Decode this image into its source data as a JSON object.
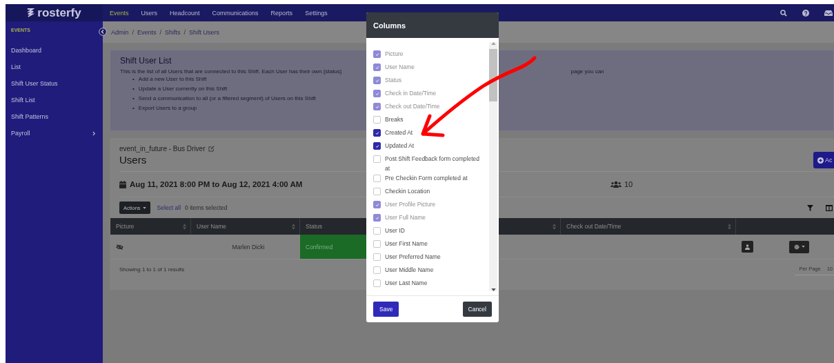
{
  "brand": {
    "name": "rosterfy"
  },
  "top_nav": [
    {
      "label": "Events",
      "selected": true
    },
    {
      "label": "Users",
      "selected": false
    },
    {
      "label": "Headcount",
      "selected": false
    },
    {
      "label": "Communications",
      "selected": false
    },
    {
      "label": "Reports",
      "selected": false
    },
    {
      "label": "Settings",
      "selected": false
    }
  ],
  "sidebar": {
    "heading": "EVENTS",
    "items": [
      {
        "label": "Dashboard",
        "expandable": false
      },
      {
        "label": "List",
        "expandable": false
      },
      {
        "label": "Shift User Status",
        "expandable": false
      },
      {
        "label": "Shift List",
        "expandable": false
      },
      {
        "label": "Shift Patterns",
        "expandable": false
      },
      {
        "label": "Payroll",
        "expandable": true
      }
    ]
  },
  "breadcrumb": [
    {
      "label": "Admin"
    },
    {
      "separator": "/",
      "label": "Events"
    },
    {
      "separator": "/",
      "label": "Shifts"
    },
    {
      "separator": "/",
      "label": "Shift Users"
    }
  ],
  "info": {
    "title": "Shift User List",
    "intro": "This is the list of all Users that are connected to this Shift. Each User has their own {status}",
    "intro_tail": "page you can",
    "bullets": [
      {
        "marker": "•",
        "text": "Add a new User to this Shift"
      },
      {
        "marker": "•",
        "text": "Update a User currently on this Shift"
      },
      {
        "marker": "•",
        "text": "Send a communication to all (or a filtered segment) of Users on this Shift"
      },
      {
        "marker": "•",
        "text": "Export Users to a group"
      }
    ]
  },
  "card": {
    "subtitle": "event_in_future - Bus Driver",
    "title": "Users",
    "add_button": "Ac",
    "date_range": "Aug 11, 2021 8:00 PM to Aug 12, 2021 4:00 AM",
    "user_count": "10",
    "actions_button": "Actions",
    "select_all": "Select all",
    "selected_count": "0 items selected"
  },
  "table": {
    "columns": [
      {
        "label": "Picture",
        "sortable": true
      },
      {
        "label": "User Name",
        "sortable": true
      },
      {
        "label": "Status"
      },
      {
        "sortable": true
      },
      {
        "label": "Check out Date/Time",
        "sortable": true
      }
    ],
    "rows": [
      {
        "picture_hidden": true,
        "user_name": "Marlen Dicki",
        "status": "Confirmed"
      }
    ],
    "summary": "Showing 1 to 1 of 1 results",
    "per_page_label": "Per Page",
    "per_page": "10"
  },
  "modal": {
    "title": "Columns",
    "options": [
      {
        "label": "Picture",
        "checked": true,
        "disabled": true
      },
      {
        "label": "User Name",
        "checked": true,
        "disabled": true
      },
      {
        "label": "Status",
        "checked": true,
        "disabled": true
      },
      {
        "label": "Check in Date/Time",
        "checked": true,
        "disabled": true
      },
      {
        "label": "Check out Date/Time",
        "checked": true,
        "disabled": true
      },
      {
        "label": "Breaks",
        "checked": false,
        "disabled": false
      },
      {
        "label": "Created At",
        "checked": true,
        "disabled": false
      },
      {
        "label": "Updated At",
        "checked": true,
        "disabled": false
      },
      {
        "label": "Post Shift Feedback form completed at",
        "checked": false,
        "disabled": false
      },
      {
        "label": "Pre Checkin Form completed at",
        "checked": false,
        "disabled": false
      },
      {
        "label": "Checkin Location",
        "checked": false,
        "disabled": false
      },
      {
        "label": "User Profile Picture",
        "checked": true,
        "disabled": true
      },
      {
        "label": "User Full Name",
        "checked": true,
        "disabled": true
      },
      {
        "label": "User ID",
        "checked": false,
        "disabled": false
      },
      {
        "label": "User First Name",
        "checked": false,
        "disabled": false
      },
      {
        "label": "User Preferred Name",
        "checked": false,
        "disabled": false
      },
      {
        "label": "User Middle Name",
        "checked": false,
        "disabled": false
      },
      {
        "label": "User Last Name",
        "checked": false,
        "disabled": false
      }
    ],
    "save": "Save",
    "cancel": "Cancel"
  }
}
